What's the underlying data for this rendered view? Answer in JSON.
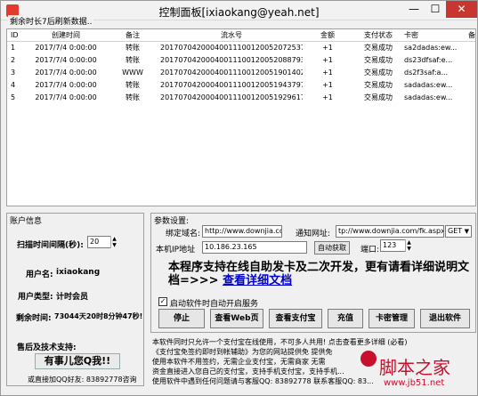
{
  "window": {
    "title": "控制面板[ixiaokang@yeah.net]",
    "sub_header": "剩余时长7后刷新数据..",
    "min_glyph": "—",
    "max_glyph": "☐",
    "close_glyph": "✕"
  },
  "grid": {
    "columns": [
      "ID",
      "创建时间",
      "备注",
      "流水号",
      "金额",
      "支付状态",
      "卡密",
      "备"
    ],
    "rows": [
      [
        "1",
        "2017/7/4 0:00:00",
        "转账",
        "20170704200040011100120052072537",
        "+1",
        "交易成功",
        "sa2dadas:ew..."
      ],
      [
        "2",
        "2017/7/4 0:00:00",
        "转账",
        "20170704200040011100120052088793",
        "+1",
        "交易成功",
        "ds23dfsaf:e..."
      ],
      [
        "3",
        "2017/7/4 0:00:00",
        "WWW",
        "20170704200040011100120051901402",
        "+1",
        "交易成功",
        "ds2f3saf:a..."
      ],
      [
        "4",
        "2017/7/4 0:00:00",
        "转账",
        "20170704200040011100120051943797",
        "+1",
        "交易成功",
        "sadadas:ew..."
      ],
      [
        "5",
        "2017/7/4 0:00:00",
        "转账",
        "20170704200040011100120051929617",
        "+1",
        "交易成功",
        "sadadas:ew..."
      ]
    ]
  },
  "account": {
    "section_label": "账户信息",
    "scan_label": "扫描时间间隔(秒):",
    "scan_value": "20",
    "username_label": "用户名:",
    "username_value": "ixiaokang",
    "usertype_label": "用户类型:",
    "usertype_value": "计时会员",
    "remaining_label": "剩余时间:",
    "remaining_value": "73044天20时8分钟47秒!",
    "support_label": "售后及技术支持:",
    "qq_text": "有事儿您Q我!!",
    "qq_note": "或直接加QQ好友: 83892778咨询"
  },
  "params": {
    "section_label": "参数设置:",
    "domain_label": "绑定域名:",
    "domain_value": "http://www.downjia.com",
    "notify_label": "通知网址:",
    "notify_value": "tp://www.downjia.com/fk.aspx",
    "method_value": "GET",
    "ip_label": "本机IP地址",
    "ip_value": "10.186.23.165",
    "auto_fetch": "自动获取",
    "port_label": "端口:",
    "port_value": "123"
  },
  "promo": {
    "text": "本程序支持在线自助发卡及二次开发，更有请看详细说明文档=>>> ",
    "link": "查看详细文档"
  },
  "autostart": {
    "label": "启动软件时自动开启服务",
    "checked": "✓"
  },
  "buttons": {
    "stop": "停止",
    "view_web": "查看Web页",
    "view_alipay": "查看支付宝",
    "recharge": "充值",
    "card_mgmt": "卡密管理",
    "exit": "退出软件"
  },
  "notice": {
    "line1": "本软件同时只允许一个支付宝在线使用，不可多人共用! 点击查看更多详细 (必看)",
    "line2": "《支付宝免签约即时到帐辅助》为您的网站提供免 提供免",
    "line3": "使用本软件不用签约，无需企业支付宝，无需商家 无需",
    "line4": "资金直接进入您自己的支付宝，支持手机支付宝，支持手机...",
    "line5": "使用软件中遇到任何问题请与客服QQ: 83892778  联系客服QQ: 83..."
  },
  "watermark": {
    "text": "脚本之家",
    "url": "www.jb51.net"
  }
}
